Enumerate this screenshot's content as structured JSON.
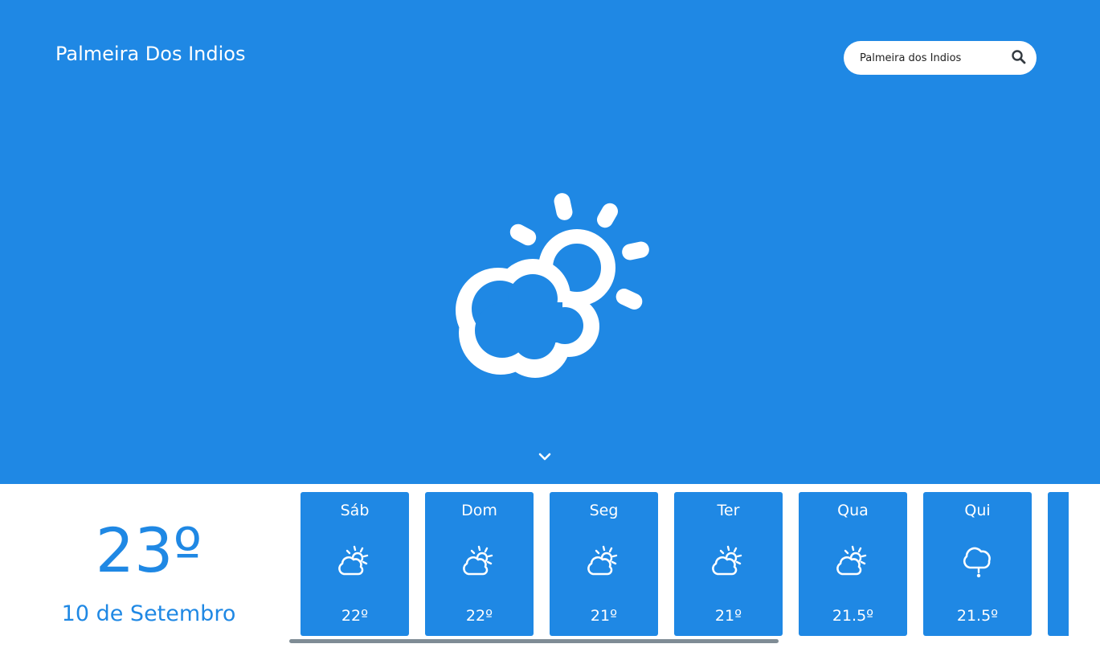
{
  "header": {
    "city": "Palmeira Dos Indios"
  },
  "search": {
    "value": "Palmeira dos Indios",
    "icon": "search-icon"
  },
  "current": {
    "icon": "partly-cloudy-icon",
    "temperature": "23º",
    "date": "10 de Setembro"
  },
  "forecast": [
    {
      "day": "Sáb",
      "temp": "22º",
      "icon": "partly-cloudy-icon"
    },
    {
      "day": "Dom",
      "temp": "22º",
      "icon": "partly-cloudy-icon"
    },
    {
      "day": "Seg",
      "temp": "21º",
      "icon": "partly-cloudy-icon"
    },
    {
      "day": "Ter",
      "temp": "21º",
      "icon": "partly-cloudy-icon"
    },
    {
      "day": "Qua",
      "temp": "21.5º",
      "icon": "partly-cloudy-icon"
    },
    {
      "day": "Qui",
      "temp": "21.5º",
      "icon": "drizzle-icon"
    }
  ],
  "colors": {
    "primary": "#1f88e4",
    "background": "#ffffff",
    "scrollbar": "#7f8c95"
  }
}
